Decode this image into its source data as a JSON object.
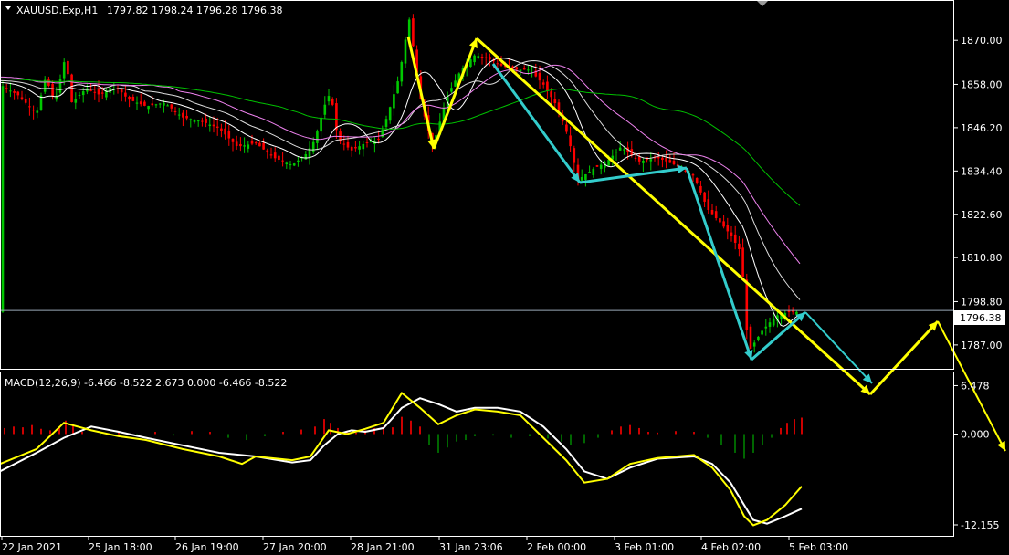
{
  "header": {
    "symbol": "XAUUSD.Exp,H1",
    "ohlc": "1797.82 1798.24 1796.28 1796.38"
  },
  "macd": {
    "label": "MACD(12,26,9) -6.466 -8.522 2.673 0.000 -6.466 -8.522"
  },
  "colors": {
    "background": "#000000",
    "bull": "#00c800",
    "bear": "#ff0000",
    "wave_yellow": "#ffff00",
    "wave_cyan": "#33cccc",
    "ma_white": "#ffffff",
    "ma_pink": "#ee82ee",
    "ma_green": "#00c000",
    "hist_pos": "#ff0000",
    "hist_neg": "#008000"
  },
  "chart_data": [
    {
      "type": "candlestick",
      "symbol": "XAUUSD.Exp",
      "timeframe": "H1",
      "y_ticks": [
        "1870.00",
        "1858.00",
        "1846.20",
        "1834.40",
        "1822.60",
        "1810.80",
        "1798.80",
        "1787.00"
      ],
      "ylim": [
        1781.0,
        1880.0
      ],
      "x_ticks": [
        "22 Jan 2021",
        "25 Jan 18:00",
        "26 Jan 19:00",
        "27 Jan 20:00",
        "28 Jan 21:00",
        "31 Jan 23:06",
        "2 Feb 00:00",
        "3 Feb 01:00",
        "4 Feb 02:00",
        "5 Feb 03:00"
      ],
      "current_price": "1796.38",
      "price_path": [
        [
          0,
          1858
        ],
        [
          20,
          1855
        ],
        [
          40,
          1850
        ],
        [
          50,
          1860
        ],
        [
          60,
          1853
        ],
        [
          72,
          1866
        ],
        [
          78,
          1853
        ],
        [
          95,
          1857
        ],
        [
          110,
          1855
        ],
        [
          125,
          1858
        ],
        [
          140,
          1854
        ],
        [
          160,
          1852
        ],
        [
          180,
          1853
        ],
        [
          200,
          1849
        ],
        [
          220,
          1848
        ],
        [
          240,
          1846
        ],
        [
          260,
          1841
        ],
        [
          280,
          1842
        ],
        [
          300,
          1838
        ],
        [
          320,
          1836
        ],
        [
          335,
          1839
        ],
        [
          345,
          1843
        ],
        [
          355,
          1852
        ],
        [
          362,
          1856
        ],
        [
          370,
          1843
        ],
        [
          385,
          1840
        ],
        [
          400,
          1842
        ],
        [
          415,
          1843
        ],
        [
          425,
          1850
        ],
        [
          437,
          1860
        ],
        [
          448,
          1876
        ],
        [
          462,
          1852
        ],
        [
          474,
          1841
        ],
        [
          490,
          1855
        ],
        [
          505,
          1862
        ],
        [
          520,
          1866
        ],
        [
          535,
          1865
        ],
        [
          550,
          1863
        ],
        [
          565,
          1862
        ],
        [
          580,
          1862
        ],
        [
          595,
          1858
        ],
        [
          610,
          1852
        ],
        [
          622,
          1844
        ],
        [
          633,
          1832
        ],
        [
          650,
          1835
        ],
        [
          665,
          1837
        ],
        [
          680,
          1841
        ],
        [
          700,
          1837
        ],
        [
          720,
          1838
        ],
        [
          740,
          1836
        ],
        [
          760,
          1833
        ],
        [
          775,
          1824
        ],
        [
          790,
          1820
        ],
        [
          800,
          1817
        ],
        [
          812,
          1812
        ],
        [
          817,
          1792
        ],
        [
          822,
          1786
        ],
        [
          835,
          1791
        ],
        [
          850,
          1795
        ],
        [
          865,
          1796
        ],
        [
          876,
          1796
        ]
      ]
    },
    {
      "type": "line",
      "title": "MACD(12,26,9)",
      "y_ticks": [
        "6.478",
        "0.000",
        "-12.155"
      ],
      "ylim": [
        -13.5,
        8.0
      ],
      "series": [
        {
          "values": [
            [
              0,
              -5
            ],
            [
              40,
              -2.5
            ],
            [
              70,
              -0.5
            ],
            [
              100,
              1.0
            ],
            [
              130,
              0.3
            ],
            [
              160,
              -0.5
            ],
            [
              200,
              -1.5
            ],
            [
              240,
              -2.5
            ],
            [
              280,
              -3.0
            ],
            [
              320,
              -3.8
            ],
            [
              340,
              -3.5
            ],
            [
              355,
              -1.5
            ],
            [
              370,
              0
            ],
            [
              385,
              0.5
            ],
            [
              400,
              0.3
            ],
            [
              420,
              0.8
            ],
            [
              440,
              3.5
            ],
            [
              460,
              4.8
            ],
            [
              480,
              4.0
            ],
            [
              500,
              3.0
            ],
            [
              520,
              3.5
            ],
            [
              545,
              3.5
            ],
            [
              570,
              3.0
            ],
            [
              595,
              1.0
            ],
            [
              620,
              -2.0
            ],
            [
              640,
              -5.0
            ],
            [
              665,
              -6.0
            ],
            [
              690,
              -4.5
            ],
            [
              720,
              -3.3
            ],
            [
              760,
              -3.0
            ],
            [
              780,
              -4.0
            ],
            [
              800,
              -6.5
            ],
            [
              815,
              -9.5
            ],
            [
              825,
              -11.5
            ],
            [
              840,
              -12.0
            ],
            [
              860,
              -11.0
            ],
            [
              878,
              -10.0
            ]
          ]
        },
        {
          "values": [
            [
              0,
              -4
            ],
            [
              40,
              -2.0
            ],
            [
              70,
              1.5
            ],
            [
              100,
              0.5
            ],
            [
              130,
              -0.3
            ],
            [
              160,
              -0.8
            ],
            [
              200,
              -2.0
            ],
            [
              240,
              -3.0
            ],
            [
              265,
              -4.0
            ],
            [
              280,
              -3.0
            ],
            [
              320,
              -3.5
            ],
            [
              340,
              -3.0
            ],
            [
              360,
              0.5
            ],
            [
              380,
              0
            ],
            [
              400,
              0.7
            ],
            [
              420,
              1.5
            ],
            [
              440,
              5.5
            ],
            [
              460,
              3.5
            ],
            [
              480,
              1.3
            ],
            [
              500,
              2.5
            ],
            [
              520,
              3.3
            ],
            [
              545,
              3.0
            ],
            [
              570,
              2.5
            ],
            [
              595,
              -0.5
            ],
            [
              620,
              -3.5
            ],
            [
              640,
              -6.5
            ],
            [
              665,
              -6.0
            ],
            [
              690,
              -4.0
            ],
            [
              720,
              -3.2
            ],
            [
              760,
              -2.8
            ],
            [
              780,
              -4.5
            ],
            [
              800,
              -7.5
            ],
            [
              815,
              -11.0
            ],
            [
              825,
              -12.2
            ],
            [
              840,
              -11.5
            ],
            [
              860,
              -9.5
            ],
            [
              878,
              -7.0
            ]
          ]
        }
      ],
      "histogram": [
        [
          5,
          0.8
        ],
        [
          15,
          1.0
        ],
        [
          25,
          0.9
        ],
        [
          35,
          1.2
        ],
        [
          45,
          0.7
        ],
        [
          55,
          0.5
        ],
        [
          65,
          0.9
        ],
        [
          72,
          1.8
        ],
        [
          80,
          1.2
        ],
        [
          90,
          0.3
        ],
        [
          110,
          -0.2
        ],
        [
          130,
          0.2
        ],
        [
          150,
          -0.3
        ],
        [
          170,
          0.3
        ],
        [
          190,
          -0.2
        ],
        [
          210,
          0.4
        ],
        [
          230,
          0.3
        ],
        [
          250,
          -0.5
        ],
        [
          270,
          -0.8
        ],
        [
          290,
          -0.3
        ],
        [
          310,
          0.3
        ],
        [
          330,
          0.6
        ],
        [
          345,
          1.0
        ],
        [
          355,
          2.0
        ],
        [
          362,
          1.5
        ],
        [
          370,
          0.8
        ],
        [
          380,
          0.4
        ],
        [
          390,
          0.2
        ],
        [
          400,
          0.5
        ],
        [
          410,
          0.8
        ],
        [
          420,
          1.0
        ],
        [
          430,
          0.9
        ],
        [
          440,
          2.3
        ],
        [
          450,
          1.8
        ],
        [
          460,
          1.0
        ],
        [
          470,
          -1.5
        ],
        [
          480,
          -2.5
        ],
        [
          490,
          -1.8
        ],
        [
          500,
          -1.0
        ],
        [
          510,
          -0.8
        ],
        [
          520,
          -0.3
        ],
        [
          540,
          -0.2
        ],
        [
          560,
          -0.5
        ],
        [
          580,
          -0.3
        ],
        [
          600,
          -0.6
        ],
        [
          615,
          -1.0
        ],
        [
          625,
          -1.5
        ],
        [
          640,
          -1.2
        ],
        [
          655,
          -0.5
        ],
        [
          670,
          0.5
        ],
        [
          680,
          1.0
        ],
        [
          690,
          1.2
        ],
        [
          700,
          0.8
        ],
        [
          710,
          0.3
        ],
        [
          720,
          0.2
        ],
        [
          740,
          0.4
        ],
        [
          760,
          0.3
        ],
        [
          775,
          -0.5
        ],
        [
          790,
          -1.5
        ],
        [
          805,
          -2.5
        ],
        [
          815,
          -3.3
        ],
        [
          825,
          -2.5
        ],
        [
          835,
          -1.5
        ],
        [
          845,
          -0.5
        ],
        [
          855,
          0.8
        ],
        [
          862,
          1.5
        ],
        [
          870,
          2.0
        ],
        [
          878,
          2.2
        ]
      ]
    }
  ]
}
